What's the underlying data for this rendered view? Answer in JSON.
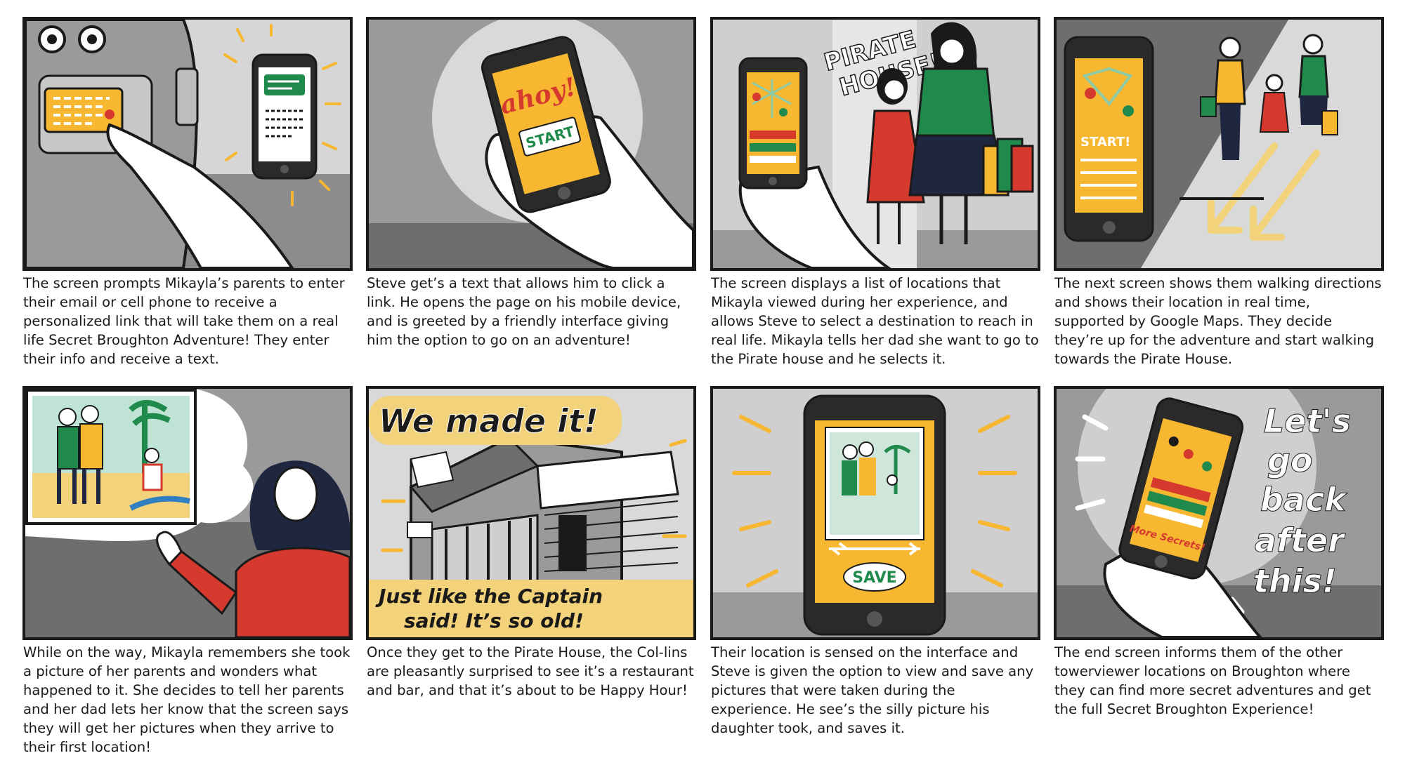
{
  "colors": {
    "accent_yellow": "#f7b731",
    "red": "#d63a2f",
    "green": "#1f8a4c",
    "ink": "#1a1a1a",
    "gray_light": "#d9d9d9",
    "gray_mid": "#9a9a9a",
    "gray_dark": "#6e6e6e"
  },
  "panels": [
    {
      "icons": [
        "towerviewer-icon",
        "pointing-hand-icon",
        "phone-text-icon"
      ],
      "caption": "The screen prompts Mikayla’s parents to enter their email or cell phone to receive a personalized link that will take them on a real life Secret Broughton Adventure! They enter their info and receive a text."
    },
    {
      "icons": [
        "hand-holding-phone-icon"
      ],
      "phone_text_1": "ahoy!",
      "phone_text_2": "START",
      "caption": "Steve get’s a text that allows him to click a link. He opens the page on his mobile device, and is greeted by a friendly interface giving him the option to go on an adventure!"
    },
    {
      "icons": [
        "phone-map-icon",
        "girl-icon",
        "mother-icon",
        "shopping-bags-icon"
      ],
      "shout_1": "PIRATE",
      "shout_2": "HOUSE!",
      "caption": "The screen displays a list of locations that Mikayla viewed during her experience, and allows Steve to select a destination to reach in real life. Mikayla tells her dad she want to go to the Pirate house and he selects it."
    },
    {
      "icons": [
        "phone-directions-icon",
        "family-walking-icon",
        "direction-arrows-icon"
      ],
      "phone_text": "START!",
      "caption": "The next screen shows them walking directions and shows their location in real time, supported by Google Maps. They decide they’re up for the adventure and start walking towards the Pirate House."
    },
    {
      "icons": [
        "photo-memory-icon",
        "thinking-girl-icon"
      ],
      "caption": "While on the way, Mikayla remembers she took a picture of her parents and wonders what happened to it. She decides to tell her parents and her dad lets her know that the screen says they will get her pictures when they arrive to their first location!"
    },
    {
      "icons": [
        "pirate-house-icon"
      ],
      "banner_top": "We made it!",
      "banner_bottom_1": "Just like the Captain",
      "banner_bottom_2": "said! It’s so old!",
      "caption": "Once they get to the Pirate House, the Col-lins are pleasantly surprised to see it’s a restaurant and bar, and that it’s about to be Happy Hour!"
    },
    {
      "icons": [
        "phone-photo-icon",
        "arrow-left-icon",
        "arrow-right-icon"
      ],
      "phone_text": "SAVE",
      "caption": "Their location is sensed on the interface and Steve is given the option to view and save any pictures that were taken during the experience. He see’s the silly picture his daughter took, and saves it."
    },
    {
      "icons": [
        "hand-holding-phone-icon",
        "map-pins-icon"
      ],
      "phone_text": "More Secrets!",
      "shout_1": "Let's",
      "shout_2": "go",
      "shout_3": "back",
      "shout_4": "after",
      "shout_5": "this!",
      "caption": "The end screen informs them of the other towerviewer locations on Broughton where they can find more secret adventures and get the full Secret Broughton Experience!"
    }
  ]
}
